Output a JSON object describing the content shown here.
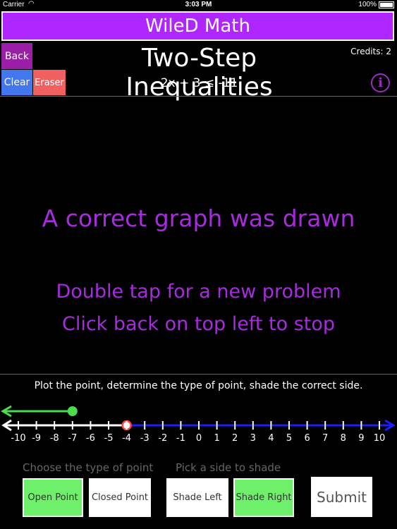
{
  "status_bar": {
    "carrier": "Carrier",
    "time": "3:03 PM",
    "battery": "100%"
  },
  "app_title": "WileD Math",
  "header": {
    "back_label": "Back",
    "clear_label": "Clear",
    "eraser_label": "Eraser",
    "title": "Two-Step Inequalities",
    "equation": "2x + 3 ≤ -11",
    "credits": "Credits: 2",
    "info_glyph": "i"
  },
  "canvas": {
    "result": "A correct graph was drawn",
    "hint_new": "Double tap for a new problem",
    "hint_stop": "Click back on top left to stop"
  },
  "instruction": "Plot the point, determine the type of point, shade the correct side.",
  "number_line": {
    "ticks": [
      "-10",
      "-9",
      "-8",
      "-7",
      "-6",
      "-5",
      "-4",
      "-3",
      "-2",
      "-1",
      "0",
      "1",
      "2",
      "3",
      "4",
      "5",
      "6",
      "7",
      "8",
      "9",
      "10"
    ],
    "student_point": -7,
    "student_point_type": "closed",
    "student_shade": "left",
    "answer_point": -4,
    "answer_point_type": "open",
    "answer_shade": "right",
    "colors": {
      "student": "#4cdc4c",
      "answer_shade": "#1d1dff",
      "answer_point": "#ff4444",
      "line": "#ffffff"
    }
  },
  "controls": {
    "point_type_label": "Choose the type of point",
    "shade_label": "Pick a side to shade",
    "open_point": "Open Point",
    "closed_point": "Closed Point",
    "shade_left": "Shade Left",
    "shade_right": "Shade Right",
    "submit": "Submit",
    "selected_point_type": "Open Point",
    "selected_shade": "Shade Right"
  },
  "colors": {
    "title_bar": "#b026ff",
    "message": "#a82be0",
    "selected": "#6ef06a"
  }
}
